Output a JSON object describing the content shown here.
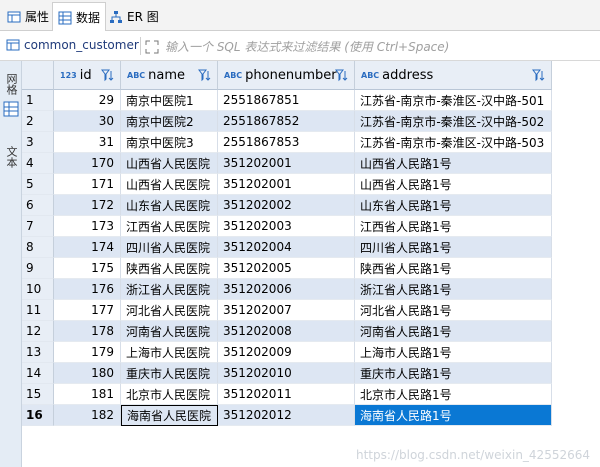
{
  "tabs": [
    {
      "label": "属性"
    },
    {
      "label": "数据"
    },
    {
      "label": "ER 图"
    }
  ],
  "filter": {
    "object_name": "common_customer",
    "placeholder": "输入一个 SQL 表达式来过滤结果 (使用 Ctrl+Space)"
  },
  "side_tabs": {
    "grid": "网格",
    "text": "文本"
  },
  "columns": [
    {
      "name": "id",
      "type": "123"
    },
    {
      "name": "name",
      "type": "ABC"
    },
    {
      "name": "phonenumber",
      "type": "ABC"
    },
    {
      "name": "address",
      "type": "ABC"
    }
  ],
  "rows": [
    {
      "n": "1",
      "id": "29",
      "name": "南京中医院1",
      "phone": "2551867851",
      "address": "江苏省-南京市-秦淮区-汉中路-501"
    },
    {
      "n": "2",
      "id": "30",
      "name": "南京中医院2",
      "phone": "2551867852",
      "address": "江苏省-南京市-秦淮区-汉中路-502"
    },
    {
      "n": "3",
      "id": "31",
      "name": "南京中医院3",
      "phone": "2551867853",
      "address": "江苏省-南京市-秦淮区-汉中路-503"
    },
    {
      "n": "4",
      "id": "170",
      "name": "山西省人民医院",
      "phone": "351202001",
      "address": "山西省人民路1号"
    },
    {
      "n": "5",
      "id": "171",
      "name": "山西省人民医院",
      "phone": "351202001",
      "address": "山西省人民路1号"
    },
    {
      "n": "6",
      "id": "172",
      "name": "山东省人民医院",
      "phone": "351202002",
      "address": "山东省人民路1号"
    },
    {
      "n": "7",
      "id": "173",
      "name": "江西省人民医院",
      "phone": "351202003",
      "address": "江西省人民路1号"
    },
    {
      "n": "8",
      "id": "174",
      "name": "四川省人民医院",
      "phone": "351202004",
      "address": "四川省人民路1号"
    },
    {
      "n": "9",
      "id": "175",
      "name": "陕西省人民医院",
      "phone": "351202005",
      "address": "陕西省人民路1号"
    },
    {
      "n": "10",
      "id": "176",
      "name": "浙江省人民医院",
      "phone": "351202006",
      "address": "浙江省人民路1号"
    },
    {
      "n": "11",
      "id": "177",
      "name": "河北省人民医院",
      "phone": "351202007",
      "address": "河北省人民路1号"
    },
    {
      "n": "12",
      "id": "178",
      "name": "河南省人民医院",
      "phone": "351202008",
      "address": "河南省人民路1号"
    },
    {
      "n": "13",
      "id": "179",
      "name": "上海市人民医院",
      "phone": "351202009",
      "address": "上海市人民路1号"
    },
    {
      "n": "14",
      "id": "180",
      "name": "重庆市人民医院",
      "phone": "351202010",
      "address": "重庆市人民路1号"
    },
    {
      "n": "15",
      "id": "181",
      "name": "北京市人民医院",
      "phone": "351202011",
      "address": "北京市人民路1号"
    },
    {
      "n": "16",
      "id": "182",
      "name": "海南省人民医院",
      "phone": "351202012",
      "address": "海南省人民路1号"
    }
  ],
  "watermark": "https://blog.csdn.net/weixin_42552664",
  "colors": {
    "selection": "#0a78d4",
    "header": "#e8eef6",
    "alt_row": "#dde6f3"
  }
}
